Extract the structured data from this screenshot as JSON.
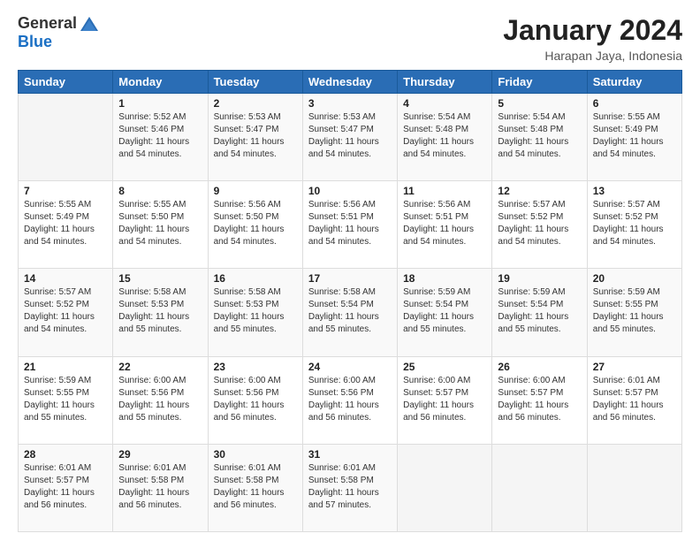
{
  "logo": {
    "general": "General",
    "blue": "Blue"
  },
  "title": "January 2024",
  "location": "Harapan Jaya, Indonesia",
  "weekdays": [
    "Sunday",
    "Monday",
    "Tuesday",
    "Wednesday",
    "Thursday",
    "Friday",
    "Saturday"
  ],
  "weeks": [
    [
      {
        "day": "",
        "sunrise": "",
        "sunset": "",
        "daylight": ""
      },
      {
        "day": "1",
        "sunrise": "Sunrise: 5:52 AM",
        "sunset": "Sunset: 5:46 PM",
        "daylight": "Daylight: 11 hours and 54 minutes."
      },
      {
        "day": "2",
        "sunrise": "Sunrise: 5:53 AM",
        "sunset": "Sunset: 5:47 PM",
        "daylight": "Daylight: 11 hours and 54 minutes."
      },
      {
        "day": "3",
        "sunrise": "Sunrise: 5:53 AM",
        "sunset": "Sunset: 5:47 PM",
        "daylight": "Daylight: 11 hours and 54 minutes."
      },
      {
        "day": "4",
        "sunrise": "Sunrise: 5:54 AM",
        "sunset": "Sunset: 5:48 PM",
        "daylight": "Daylight: 11 hours and 54 minutes."
      },
      {
        "day": "5",
        "sunrise": "Sunrise: 5:54 AM",
        "sunset": "Sunset: 5:48 PM",
        "daylight": "Daylight: 11 hours and 54 minutes."
      },
      {
        "day": "6",
        "sunrise": "Sunrise: 5:55 AM",
        "sunset": "Sunset: 5:49 PM",
        "daylight": "Daylight: 11 hours and 54 minutes."
      }
    ],
    [
      {
        "day": "7",
        "sunrise": "Sunrise: 5:55 AM",
        "sunset": "Sunset: 5:49 PM",
        "daylight": "Daylight: 11 hours and 54 minutes."
      },
      {
        "day": "8",
        "sunrise": "Sunrise: 5:55 AM",
        "sunset": "Sunset: 5:50 PM",
        "daylight": "Daylight: 11 hours and 54 minutes."
      },
      {
        "day": "9",
        "sunrise": "Sunrise: 5:56 AM",
        "sunset": "Sunset: 5:50 PM",
        "daylight": "Daylight: 11 hours and 54 minutes."
      },
      {
        "day": "10",
        "sunrise": "Sunrise: 5:56 AM",
        "sunset": "Sunset: 5:51 PM",
        "daylight": "Daylight: 11 hours and 54 minutes."
      },
      {
        "day": "11",
        "sunrise": "Sunrise: 5:56 AM",
        "sunset": "Sunset: 5:51 PM",
        "daylight": "Daylight: 11 hours and 54 minutes."
      },
      {
        "day": "12",
        "sunrise": "Sunrise: 5:57 AM",
        "sunset": "Sunset: 5:52 PM",
        "daylight": "Daylight: 11 hours and 54 minutes."
      },
      {
        "day": "13",
        "sunrise": "Sunrise: 5:57 AM",
        "sunset": "Sunset: 5:52 PM",
        "daylight": "Daylight: 11 hours and 54 minutes."
      }
    ],
    [
      {
        "day": "14",
        "sunrise": "Sunrise: 5:57 AM",
        "sunset": "Sunset: 5:52 PM",
        "daylight": "Daylight: 11 hours and 54 minutes."
      },
      {
        "day": "15",
        "sunrise": "Sunrise: 5:58 AM",
        "sunset": "Sunset: 5:53 PM",
        "daylight": "Daylight: 11 hours and 55 minutes."
      },
      {
        "day": "16",
        "sunrise": "Sunrise: 5:58 AM",
        "sunset": "Sunset: 5:53 PM",
        "daylight": "Daylight: 11 hours and 55 minutes."
      },
      {
        "day": "17",
        "sunrise": "Sunrise: 5:58 AM",
        "sunset": "Sunset: 5:54 PM",
        "daylight": "Daylight: 11 hours and 55 minutes."
      },
      {
        "day": "18",
        "sunrise": "Sunrise: 5:59 AM",
        "sunset": "Sunset: 5:54 PM",
        "daylight": "Daylight: 11 hours and 55 minutes."
      },
      {
        "day": "19",
        "sunrise": "Sunrise: 5:59 AM",
        "sunset": "Sunset: 5:54 PM",
        "daylight": "Daylight: 11 hours and 55 minutes."
      },
      {
        "day": "20",
        "sunrise": "Sunrise: 5:59 AM",
        "sunset": "Sunset: 5:55 PM",
        "daylight": "Daylight: 11 hours and 55 minutes."
      }
    ],
    [
      {
        "day": "21",
        "sunrise": "Sunrise: 5:59 AM",
        "sunset": "Sunset: 5:55 PM",
        "daylight": "Daylight: 11 hours and 55 minutes."
      },
      {
        "day": "22",
        "sunrise": "Sunrise: 6:00 AM",
        "sunset": "Sunset: 5:56 PM",
        "daylight": "Daylight: 11 hours and 55 minutes."
      },
      {
        "day": "23",
        "sunrise": "Sunrise: 6:00 AM",
        "sunset": "Sunset: 5:56 PM",
        "daylight": "Daylight: 11 hours and 56 minutes."
      },
      {
        "day": "24",
        "sunrise": "Sunrise: 6:00 AM",
        "sunset": "Sunset: 5:56 PM",
        "daylight": "Daylight: 11 hours and 56 minutes."
      },
      {
        "day": "25",
        "sunrise": "Sunrise: 6:00 AM",
        "sunset": "Sunset: 5:57 PM",
        "daylight": "Daylight: 11 hours and 56 minutes."
      },
      {
        "day": "26",
        "sunrise": "Sunrise: 6:00 AM",
        "sunset": "Sunset: 5:57 PM",
        "daylight": "Daylight: 11 hours and 56 minutes."
      },
      {
        "day": "27",
        "sunrise": "Sunrise: 6:01 AM",
        "sunset": "Sunset: 5:57 PM",
        "daylight": "Daylight: 11 hours and 56 minutes."
      }
    ],
    [
      {
        "day": "28",
        "sunrise": "Sunrise: 6:01 AM",
        "sunset": "Sunset: 5:57 PM",
        "daylight": "Daylight: 11 hours and 56 minutes."
      },
      {
        "day": "29",
        "sunrise": "Sunrise: 6:01 AM",
        "sunset": "Sunset: 5:58 PM",
        "daylight": "Daylight: 11 hours and 56 minutes."
      },
      {
        "day": "30",
        "sunrise": "Sunrise: 6:01 AM",
        "sunset": "Sunset: 5:58 PM",
        "daylight": "Daylight: 11 hours and 56 minutes."
      },
      {
        "day": "31",
        "sunrise": "Sunrise: 6:01 AM",
        "sunset": "Sunset: 5:58 PM",
        "daylight": "Daylight: 11 hours and 57 minutes."
      },
      {
        "day": "",
        "sunrise": "",
        "sunset": "",
        "daylight": ""
      },
      {
        "day": "",
        "sunrise": "",
        "sunset": "",
        "daylight": ""
      },
      {
        "day": "",
        "sunrise": "",
        "sunset": "",
        "daylight": ""
      }
    ]
  ]
}
